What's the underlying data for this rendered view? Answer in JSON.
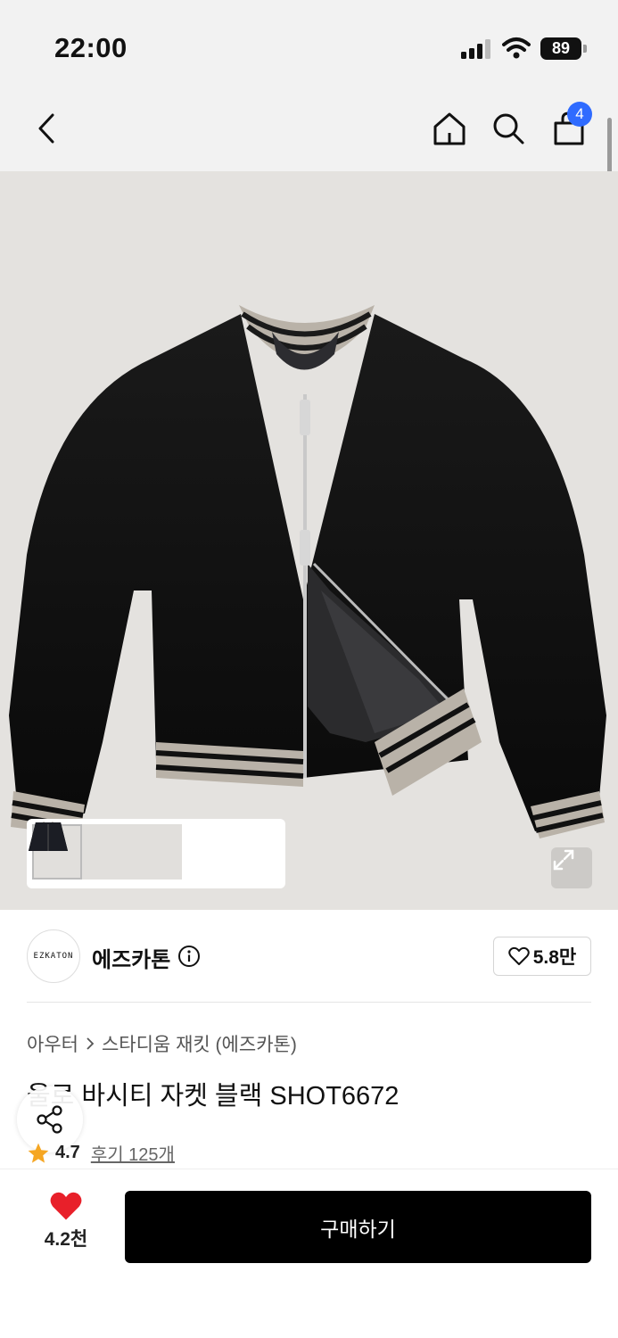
{
  "status_bar": {
    "time": "22:00",
    "battery": "89"
  },
  "nav": {
    "cart_count": "4"
  },
  "colors": {
    "accent_blue": "#2f6bff",
    "heart_red": "#e8202a",
    "buy_button": "#000000"
  },
  "icons": {
    "back": "chevron-left-icon",
    "home": "home-icon",
    "search": "search-icon",
    "cart": "shopping-bag-icon",
    "expand": "expand-icon",
    "info": "info-icon",
    "share": "share-icon",
    "heart": "heart-icon",
    "star": "star-icon"
  },
  "brand": {
    "logo_text": "EZKATON",
    "name": "에즈카톤",
    "likes": "5.8만"
  },
  "breadcrumb": {
    "category": "아우터",
    "subcategory": "스타디움 재킷 (에즈카톤)"
  },
  "product": {
    "title": "울로 바시티 자켓 블랙 SHOT6672",
    "rating": "4.7",
    "reviews": "후기 125개"
  },
  "bottom": {
    "wish_count": "4.2천",
    "buy_label": "구매하기"
  }
}
